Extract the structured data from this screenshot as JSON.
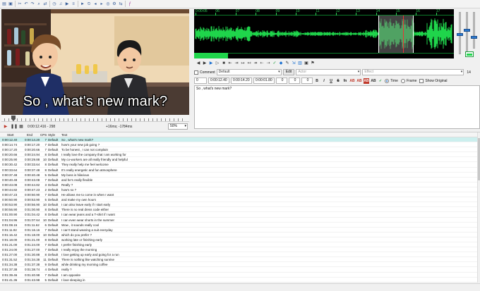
{
  "toolbar": {
    "icons": [
      "folder-icon",
      "save-icon",
      "cut-icon",
      "undo-icon",
      "redo-icon",
      "find-icon",
      "replace-icon",
      "clock-icon",
      "audio-icon",
      "video-icon",
      "subtitle-icon",
      "play-icon",
      "timer-icon",
      "lead-in-icon",
      "lead-out-icon",
      "snap-icon",
      "cog-icon",
      "shift-icon",
      "fx-icon"
    ]
  },
  "video": {
    "subtitle_text": "So , what's new mark?",
    "time_display": "0:00:12.416 - 298",
    "offset_display": "+16ms; -1784ms",
    "zoom": "50%"
  },
  "audio": {
    "ruler": [
      "0:00:05",
      "06",
      "07",
      "08",
      "09",
      "10",
      "11",
      "12",
      "13",
      "14",
      "15",
      "16",
      "17"
    ]
  },
  "edit": {
    "comment_label": "Comment",
    "style": "Default",
    "edit_button": "Edit",
    "actor_placeholder": "Actor",
    "effect_placeholder": "Effect",
    "char_count": "14",
    "layer": "0",
    "start_time": "0:00:12.40",
    "end_time": "0:00:14.20",
    "duration": "0:00:01.80",
    "margin_l": "0",
    "margin_r": "0",
    "margin_v": "0",
    "format_buttons": [
      "B",
      "I",
      "U",
      "S",
      "fn",
      "AB",
      "AB",
      "AB",
      "AB"
    ],
    "time_radio": "Time",
    "frame_radio": "Frame",
    "show_original": "Show Original",
    "text": "So , what's new mark?"
  },
  "grid": {
    "headers": {
      "start": "Start",
      "end": "End",
      "cps": "CPS",
      "style": "Style",
      "text": "Text"
    },
    "rows": [
      {
        "start": "0:00:12.40",
        "end": "0:00:14.20",
        "cps": "7",
        "style": "Default",
        "text": "So , what's new mark?",
        "selected": true
      },
      {
        "start": "0:00:14.74",
        "end": "0:00:17.20",
        "cps": "7",
        "style": "Default",
        "text": "how's your new job going ?"
      },
      {
        "start": "0:00:17.20",
        "end": "0:00:20.66",
        "cps": "7",
        "style": "Default",
        "text": "To be honest , I can not complain"
      },
      {
        "start": "0:00:20.66",
        "end": "0:00:24.94",
        "cps": "8",
        "style": "Default",
        "text": "I really love the company that I am working for"
      },
      {
        "start": "0:00:25.90",
        "end": "0:00:29.88",
        "cps": "10",
        "style": "Default",
        "text": "My co-workers are all really friendly and helpful"
      },
      {
        "start": "0:00:30.42",
        "end": "0:00:33.64",
        "cps": "8",
        "style": "Default",
        "text": "They really help me feel welcome"
      },
      {
        "start": "0:00:33.64",
        "end": "0:00:37.48",
        "cps": "8",
        "style": "Default",
        "text": "It's really energetic and fun atmosphere"
      },
      {
        "start": "0:00:37.48",
        "end": "0:00:40.48",
        "cps": "5",
        "style": "Default",
        "text": "My boss is hilarious"
      },
      {
        "start": "0:00:40.48",
        "end": "0:00:43.08",
        "cps": "7",
        "style": "Default",
        "text": "and he's really flexible"
      },
      {
        "start": "0:00:43.08",
        "end": "0:00:44.82",
        "cps": "3",
        "style": "Default",
        "text": "Really ?"
      },
      {
        "start": "0:00:44.82",
        "end": "0:00:47.23",
        "cps": "2",
        "style": "Default",
        "text": "how's so ?"
      },
      {
        "start": "0:00:47.23",
        "end": "0:00:50.90",
        "cps": "7",
        "style": "Default",
        "text": "He allows me to come in when I want"
      },
      {
        "start": "0:00:50.90",
        "end": "0:00:53.90",
        "cps": "5",
        "style": "Default",
        "text": "and make my own hours"
      },
      {
        "start": "0:00:53.90",
        "end": "0:00:56.90",
        "cps": "10",
        "style": "Default",
        "text": "I can also leave early if I start early"
      },
      {
        "start": "0:00:56.90",
        "end": "0:01:00.90",
        "cps": "8",
        "style": "Default",
        "text": "There is no real dress code either"
      },
      {
        "start": "0:01:00.90",
        "end": "0:01:04.42",
        "cps": "8",
        "style": "Default",
        "text": "I can wear jeans and a T-shirt if I want"
      },
      {
        "start": "0:01:04.96",
        "end": "0:01:07.64",
        "cps": "10",
        "style": "Default",
        "text": "I can even wear shorts in the summer"
      },
      {
        "start": "0:01:08.15",
        "end": "0:01:11.62",
        "cps": "6",
        "style": "Default",
        "text": "Wow , it sounds really cool"
      },
      {
        "start": "0:01:11.92",
        "end": "0:01:16.16",
        "cps": "7",
        "style": "Default",
        "text": "I can't stand wearing a suit everyday"
      },
      {
        "start": "0:01:16.42",
        "end": "0:01:18.00",
        "cps": "10",
        "style": "Default",
        "text": "which do you prefer ?"
      },
      {
        "start": "0:01:18.00",
        "end": "0:01:21.00",
        "cps": "8",
        "style": "Default",
        "text": "working late or finishing early"
      },
      {
        "start": "0:01:21.00",
        "end": "0:01:24.00",
        "cps": "7",
        "style": "Default",
        "text": "I prefer finishing early"
      },
      {
        "start": "0:01:24.00",
        "end": "0:01:27.00",
        "cps": "7",
        "style": "Default",
        "text": "I really enjoy the morning"
      },
      {
        "start": "0:01:27.00",
        "end": "0:01:30.88",
        "cps": "8",
        "style": "Default",
        "text": "I love getting up early and going for a run"
      },
      {
        "start": "0:01:31.52",
        "end": "0:01:34.38",
        "cps": "11",
        "style": "Default",
        "text": "There is nothing like watching sunrise"
      },
      {
        "start": "0:01:34.38",
        "end": "0:01:37.38",
        "cps": "9",
        "style": "Default",
        "text": "while drinking my morning coffee"
      },
      {
        "start": "0:01:37.38",
        "end": "0:01:38.74",
        "cps": "4",
        "style": "Default",
        "text": "really ?"
      },
      {
        "start": "0:01:39.46",
        "end": "0:01:40.98",
        "cps": "7",
        "style": "Default",
        "text": "I am opposite"
      },
      {
        "start": "0:01:41.36",
        "end": "0:01:43.98",
        "cps": "5",
        "style": "Default",
        "text": "I love sleeping in"
      }
    ]
  }
}
